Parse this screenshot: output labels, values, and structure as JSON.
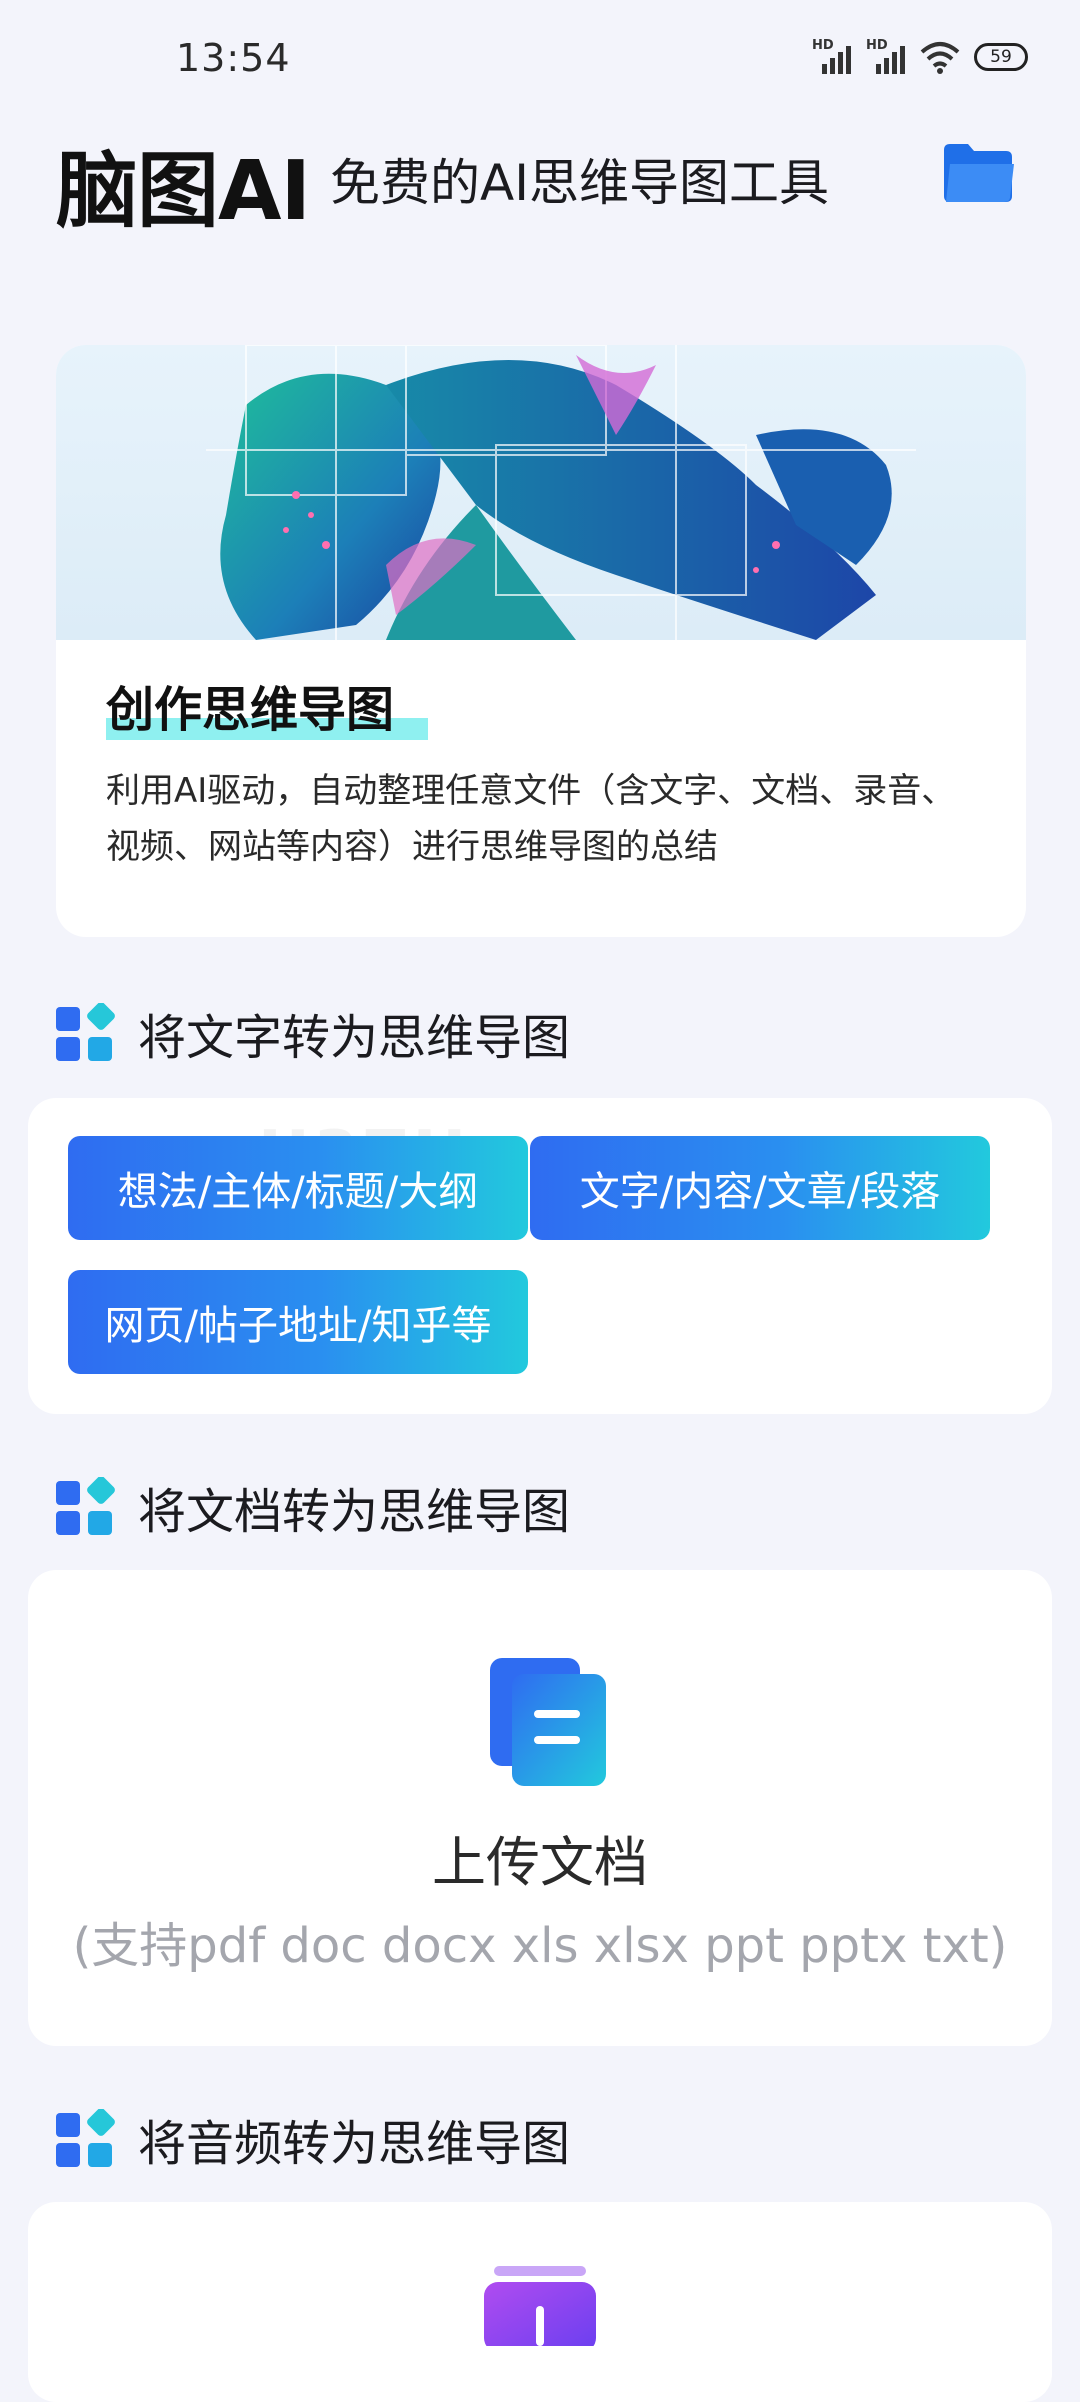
{
  "status": {
    "time": "13:54",
    "signal_1_label": "HD",
    "signal_2_label": "HD",
    "battery": "59"
  },
  "header": {
    "title": "脑图AI",
    "subtitle": "免费的AI思维导图工具"
  },
  "hero": {
    "title": "创作思维导图",
    "description": "利用AI驱动，自动整理任意文件（含文字、文档、录音、视频、网站等内容）进行思维导图的总结"
  },
  "sections": {
    "text": {
      "title": "将文字转为思维导图",
      "chips": [
        "想法/主体/标题/大纲",
        "文字/内容/文章/段落",
        "网页/帖子地址/知乎等"
      ]
    },
    "document": {
      "title": "将文档转为思维导图",
      "upload_label": "上传文档",
      "upload_hint": "(支持pdf doc docx xls xlsx ppt pptx txt)"
    },
    "audio": {
      "title": "将音频转为思维导图"
    }
  },
  "colors": {
    "accent": "#2f6cf1",
    "accent_end": "#22c9dd",
    "background": "#f3f4fb"
  }
}
